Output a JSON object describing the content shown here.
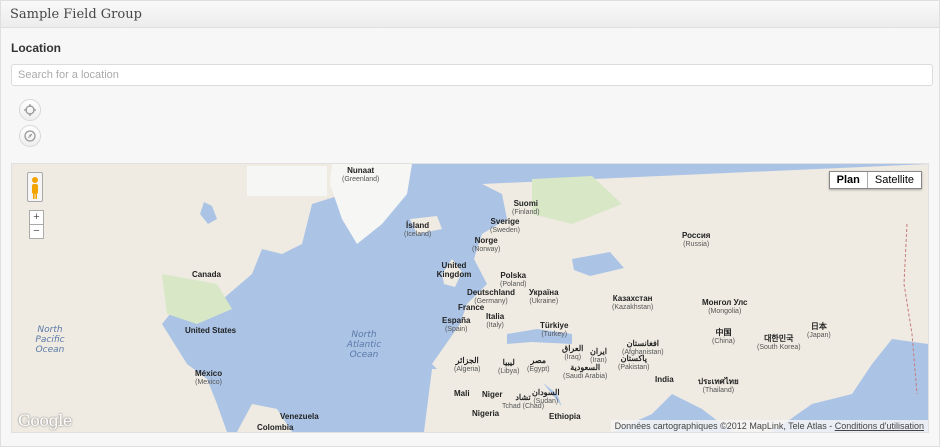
{
  "box": {
    "title": "Sample Field Group"
  },
  "field": {
    "label": "Location",
    "search_placeholder": "Search for a location"
  },
  "controls": {
    "locate_icon": "crosshair-icon",
    "compass_icon": "compass-icon"
  },
  "map": {
    "zoom_in": "+",
    "zoom_out": "−",
    "types": [
      "Plan",
      "Satellite"
    ],
    "selected_type": "Plan",
    "logo": "Google",
    "attribution": "Données cartographiques ©2012 MapLink, Tele Atlas -",
    "terms_link": "Conditions d'utilisation",
    "labels": {
      "nunaat": "Nunaat",
      "greenland": "(Greenland)",
      "suomi": "Suomi",
      "finland": "(Finland)",
      "island": "Ísland",
      "iceland": "(Iceland)",
      "sverige": "Sverige",
      "sweden": "(Sweden)",
      "norge": "Norge",
      "norway": "(Norway)",
      "russia_local": "Россия",
      "russia": "(Russia)",
      "canada": "Canada",
      "uk": "United Kingdom",
      "polska": "Polska",
      "poland": "(Poland)",
      "deutschland": "Deutschland",
      "germany": "(Germany)",
      "ukraina": "Україна",
      "ukraine": "(Ukraine)",
      "kazakhstan_local": "Казахстан",
      "kazakhstan": "(Kazakhstan)",
      "mongolia_local": "Монгол Улс",
      "mongolia": "(Mongolia)",
      "france": "France",
      "usa": "United States",
      "espana": "España",
      "spain": "(Spain)",
      "italia": "Italia",
      "italy": "(Italy)",
      "turkiye": "Türkiye",
      "turkey": "(Turkey)",
      "japan_local": "日本",
      "japan": "(Japan)",
      "korea_local": "대한민국",
      "south_korea": "(South Korea)",
      "china_local": "中国",
      "china": "(China)",
      "iraq_local": "العراق",
      "iraq": "(Iraq)",
      "iran_local": "ایران",
      "iran": "(Iran)",
      "afghanistan_local": "افغانستان",
      "afghanistan": "(Afghanistan)",
      "pakistan_local": "پاکستان",
      "pakistan": "(Pakistan)",
      "algeria_local": "الجزائر",
      "algeria": "(Algeria)",
      "libya_local": "ليبيا",
      "libya": "(Libya)",
      "egypt_local": "مصر",
      "egypt": "(Egypt)",
      "saudi_local": "السعودية",
      "saudi": "(Saudi Arabia)",
      "india": "India",
      "thailand_local": "ประเทศไทย",
      "thailand": "(Thailand)",
      "mexico_local": "México",
      "mexico": "(Mexico)",
      "mali": "Mali",
      "niger": "Niger",
      "chad_local": "تشاد",
      "chad": "Tchad (Chad)",
      "sudan_local": "السودان",
      "sudan": "(Sudan)",
      "nigeria": "Nigeria",
      "ethiopia": "Ethiopia",
      "venezuela": "Venezuela",
      "colombia": "Colombia",
      "north_pacific": "North Pacific Ocean",
      "north_atlantic": "North Atlantic Ocean"
    }
  }
}
